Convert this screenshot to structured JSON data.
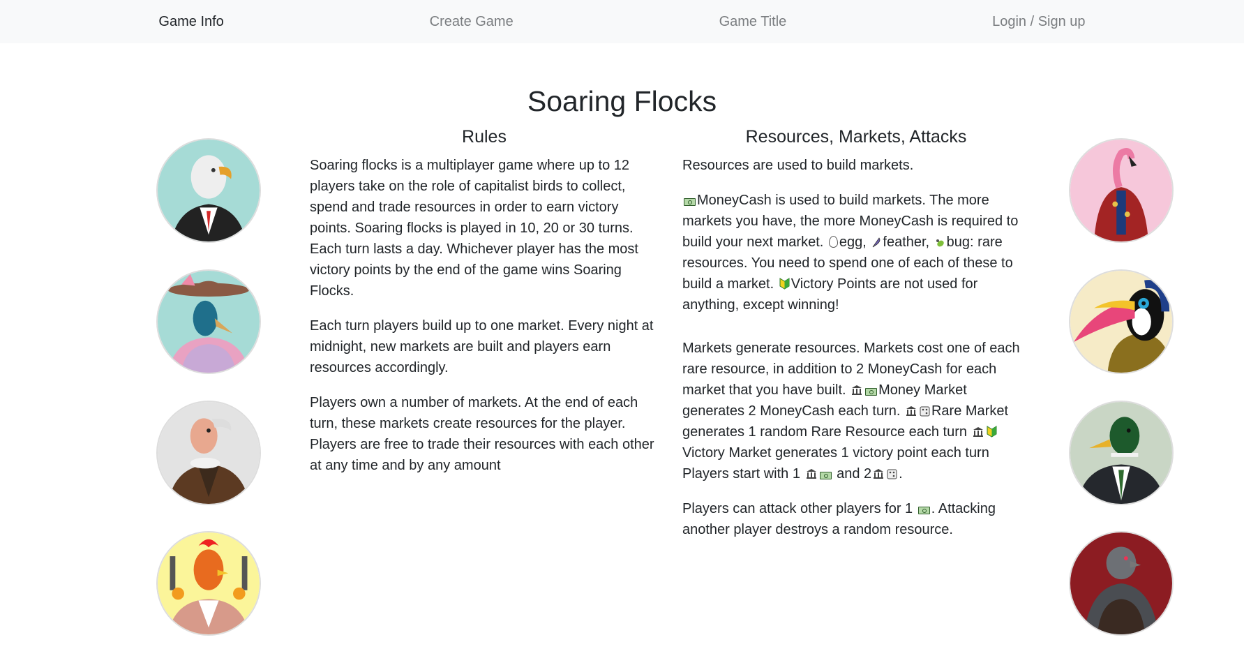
{
  "nav": {
    "game_info": "Game Info",
    "create_game": "Create Game",
    "game_title": "Game Title",
    "login": "Login / Sign up"
  },
  "page": {
    "title": "Soaring Flocks"
  },
  "rules": {
    "heading": "Rules",
    "p1": "Soaring flocks is a multiplayer game where up to 12 players take on the role of capitalist birds to collect, spend and trade resources in order to earn victory points. Soaring flocks is played in 10, 20 or 30 turns. Each turn lasts a day. Whichever player has the most victory points by the end of the game wins Soaring Flocks.",
    "p2": "Each turn players build up to one market. Every night at midnight, new markets are built and players earn resources accordingly.",
    "p3": "Players own a number of markets. At the end of each turn, these markets create resources for the player. Players are free to trade their resources with each other at any time and by any amount"
  },
  "resources": {
    "heading": "Resources, Markets, Attacks",
    "p1": "Resources are used to build markets.",
    "p2_a": "MoneyCash is used to build markets. The more markets you have, the more MoneyCash is required to build your next market.",
    "p2_egg": "egg,",
    "p2_feather": "feather,",
    "p2_bug": "bug: rare resources. You need to spend one of each of these to build a market.",
    "p2_vp": "Victory Points are not used for anything, except winning!",
    "p3_a": "Markets generate resources. Markets cost one of each rare resource, in addition to 2 MoneyCash for each market that you have built.",
    "p3_money": "Money Market generates 2 MoneyCash each turn.",
    "p3_rare": "Rare Market generates 1 random Rare Resource each turn",
    "p3_victory": "Victory Market generates 1 victory point each turn",
    "p3_start": "Players start with 1",
    "p3_and": "and 2",
    "p3_end": ".",
    "p4_a": "Players can attack other players for 1",
    "p4_b": ". Attacking another player destroys a random resource."
  },
  "avatars": {
    "left": [
      "eagle-avatar",
      "peacock-avatar",
      "vulture-avatar",
      "rooster-avatar"
    ],
    "right": [
      "flamingo-avatar",
      "toucan-avatar",
      "duck-avatar",
      "pigeon-avatar"
    ]
  },
  "colors": {
    "nav_bg": "#f8f9fa",
    "nav_active": "#212529",
    "nav_inactive": "#7a7d80",
    "teal_bg": "#a6dbd6",
    "pink_bg": "#f6c7da",
    "cream_bg": "#f6ebc7",
    "sage_bg": "#c9d6c5",
    "grey_bg": "#e3e3e3",
    "yellow_bg": "#fbf59a",
    "red_bg": "#8c1c22"
  }
}
